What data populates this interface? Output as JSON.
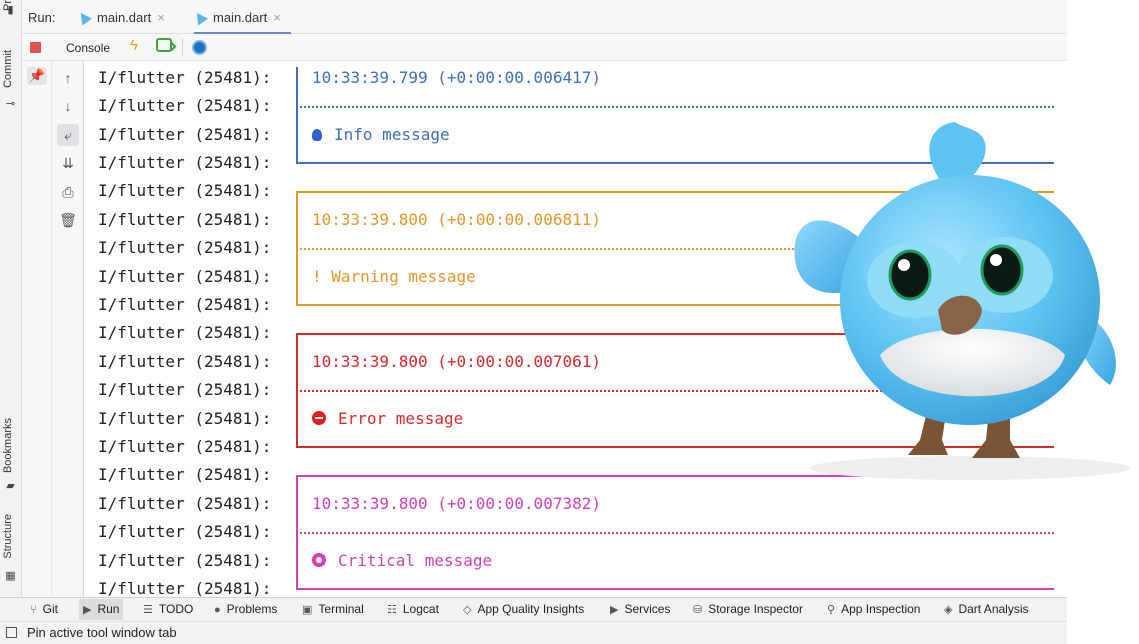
{
  "left_strip": {
    "labels": [
      "Pr",
      "Commit",
      "Bookmarks",
      "Structure"
    ]
  },
  "tabbar": {
    "run_label": "Run:",
    "tabs": [
      {
        "label": "main.dart",
        "close": "×"
      },
      {
        "label": "main.dart",
        "close": "×"
      }
    ]
  },
  "toolbar": {
    "console_label": "Console"
  },
  "console": {
    "prefix": "I/flutter (25481):",
    "messages": {
      "info_time": "10:33:39.799 (+0:00:00.006417)",
      "info_text": "Info message",
      "warning_time": "10:33:39.800 (+0:00:00.006811)",
      "warning_text": "! Warning message",
      "error_time": "10:33:39.800 (+0:00:00.007061)",
      "error_text": "Error message",
      "critical_time": "10:33:39.800 (+0:00:00.007382)",
      "critical_text": "Critical message"
    },
    "colors": {
      "info": "#3f6fba",
      "warning": "#e8952a",
      "error": "#d82a2a",
      "critical": "#d33fb6"
    }
  },
  "bottombar": {
    "tabs": [
      {
        "label": "Git",
        "icon": "branch-icon"
      },
      {
        "label": "Run",
        "icon": "play-icon"
      },
      {
        "label": "TODO",
        "icon": "list-icon"
      },
      {
        "label": "Problems",
        "icon": "problems-icon"
      },
      {
        "label": "Terminal",
        "icon": "terminal-icon"
      },
      {
        "label": "Logcat",
        "icon": "logcat-icon"
      },
      {
        "label": "App Quality Insights",
        "icon": "diamond-icon"
      },
      {
        "label": "Services",
        "icon": "services-icon"
      },
      {
        "label": "Storage Inspector",
        "icon": "storage-icon"
      },
      {
        "label": "App Inspection",
        "icon": "inspection-icon"
      },
      {
        "label": "Dart Analysis",
        "icon": "dart-icon"
      }
    ]
  },
  "statusbar": {
    "text": "Pin active tool window tab"
  }
}
